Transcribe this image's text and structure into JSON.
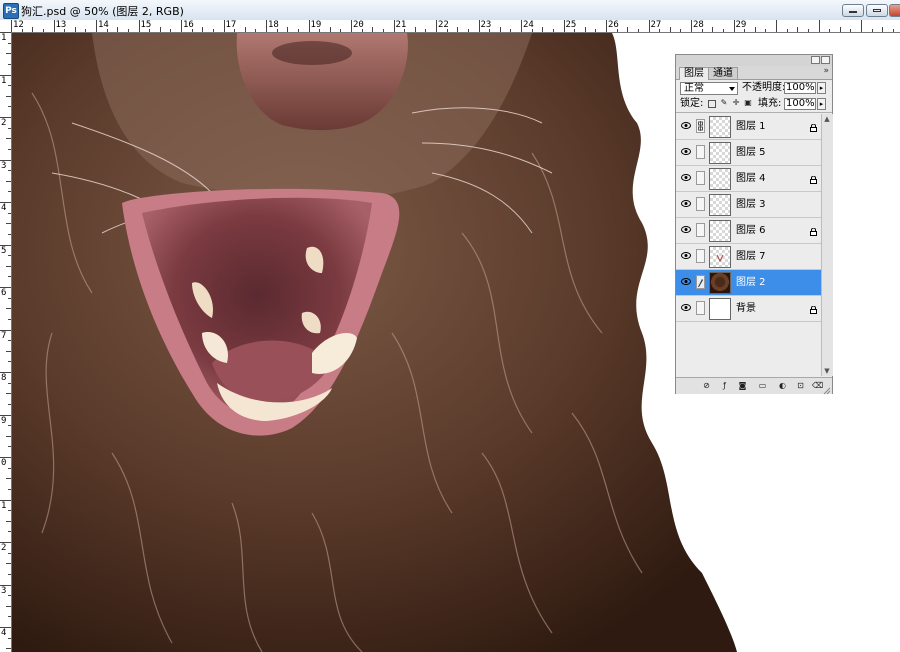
{
  "window": {
    "title": "狗汇.psd @ 50% (图层 2, RGB)",
    "doc_icon_glyph": "Ps"
  },
  "ruler": {
    "top_numbers": [
      "12",
      "13",
      "14",
      "15",
      "16",
      "17",
      "18",
      "19",
      "20",
      "21",
      "22",
      "23",
      "24",
      "25",
      "26",
      "27",
      "28",
      "29"
    ],
    "left_numbers": [
      "1",
      "1",
      "2",
      "3",
      "4",
      "5",
      "6",
      "7",
      "8",
      "9",
      "0",
      "1",
      "2",
      "3",
      "4"
    ]
  },
  "layers_panel": {
    "tabs": [
      {
        "label": "图层",
        "active": true
      },
      {
        "label": "通道",
        "active": false
      }
    ],
    "blend_mode": "正常",
    "opacity_label": "不透明度:",
    "opacity_value": "100%",
    "lock_label": "锁定:",
    "fill_label": "填充:",
    "fill_value": "100%",
    "layers": [
      {
        "name": "图层 1",
        "thumb": "transparent",
        "locked": true,
        "selected": false,
        "linked": true
      },
      {
        "name": "图层 5",
        "thumb": "transparent",
        "locked": false,
        "selected": false,
        "linked": false
      },
      {
        "name": "图层 4",
        "thumb": "transparent",
        "locked": true,
        "selected": false,
        "linked": false
      },
      {
        "name": "图层 3",
        "thumb": "transparent",
        "locked": false,
        "selected": false,
        "linked": false
      },
      {
        "name": "图层 6",
        "thumb": "transparent",
        "locked": true,
        "selected": false,
        "linked": false
      },
      {
        "name": "图层 7",
        "thumb": "transparent",
        "locked": false,
        "selected": false,
        "linked": false
      },
      {
        "name": "图层 2",
        "thumb": "dog",
        "locked": false,
        "selected": true,
        "linked": false
      },
      {
        "name": "背景",
        "thumb": "white",
        "locked": true,
        "selected": false,
        "linked": false
      }
    ],
    "bottom_icons": [
      "link-layers-icon",
      "layer-style-icon",
      "layer-mask-icon",
      "new-group-icon",
      "adjustment-layer-icon",
      "new-layer-icon",
      "delete-layer-icon"
    ]
  },
  "colors": {
    "selection": "#3d8ee8",
    "fur_dark": "#3a2418",
    "fur_mid": "#6b4a38",
    "fur_light": "#b89484"
  }
}
